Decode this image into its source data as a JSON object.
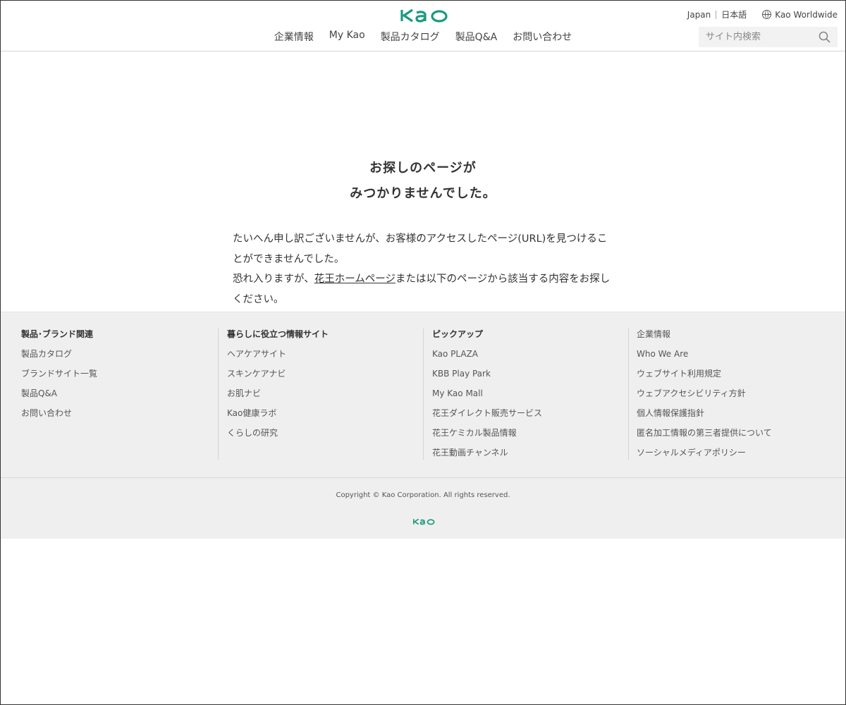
{
  "header": {
    "logo_text": "Kao",
    "region": "Japan",
    "language": "日本語",
    "worldwide": "Kao Worldwide",
    "nav": [
      "企業情報",
      "My Kao",
      "製品カタログ",
      "製品Q&A",
      "お問い合わせ"
    ],
    "search": {
      "placeholder": "サイト内検索",
      "value": ""
    }
  },
  "main": {
    "title_line1": "お探しのページが",
    "title_line2": "みつかりませんでした。",
    "paragraph1": "たいへん申し訳ございませんが、お客様のアクセスしたページ(URL)を見つけることができませんでした。",
    "paragraph2_pre": "恐れ入りますが、",
    "home_link": "花王ホームページ",
    "paragraph2_post": "または以下のページから該当する内容をお探しください。"
  },
  "footer": {
    "columns": [
      {
        "heading": "製品･ブランド関連",
        "links": [
          "製品カタログ",
          "ブランドサイト一覧",
          "製品Q&A",
          "お問い合わせ"
        ]
      },
      {
        "heading": "暮らしに役立つ情報サイト",
        "links": [
          "ヘアケアサイト",
          "スキンケアナビ",
          "お肌ナビ",
          "Kao健康ラボ",
          "くらしの研究"
        ]
      },
      {
        "heading": "ピックアップ",
        "links": [
          "Kao PLAZA",
          "KBB Play Park",
          "My Kao Mall",
          "花王ダイレクト販売サービス",
          "花王ケミカル製品情報",
          "花王動画チャンネル"
        ]
      },
      {
        "heading": "企業情報",
        "links": [
          "Who We Are",
          "ウェブサイト利用規定",
          "ウェブアクセシビリティ方針",
          "個人情報保護指針",
          "匿名加工情報の第三者提供について",
          "ソーシャルメディアポリシー"
        ]
      }
    ],
    "copyright": "Copyright © Kao Corporation. All rights reserved.",
    "logo_text": "Kao"
  },
  "colors": {
    "brand": "#1a9a7e",
    "footer_bg": "#efefef",
    "text": "#333333"
  }
}
